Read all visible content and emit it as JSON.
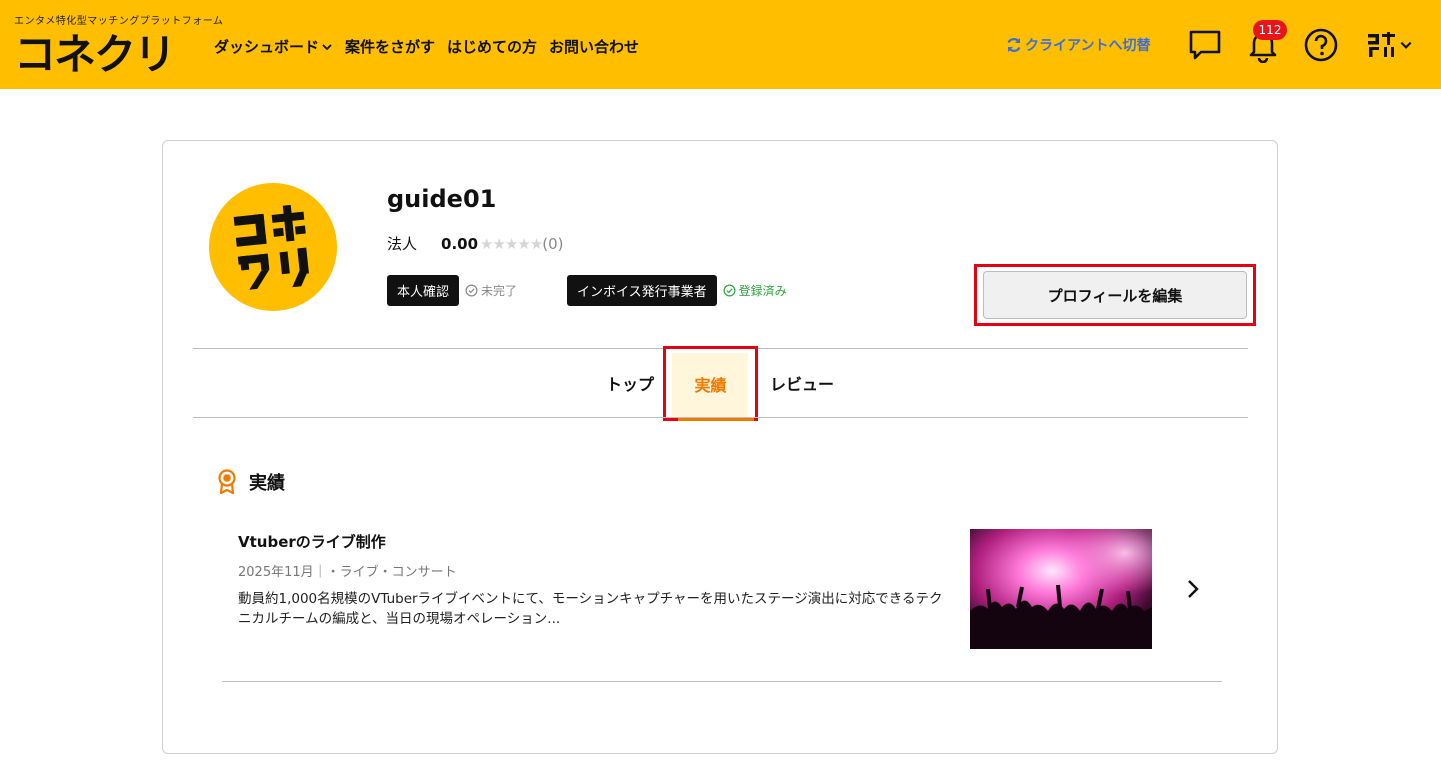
{
  "header": {
    "tagline": "エンタメ特化型マッチングプラットフォーム",
    "logo_text": "コネクリ",
    "nav": [
      {
        "label": "ダッシュボード"
      },
      {
        "label": "案件をさがす"
      },
      {
        "label": "はじめての方"
      },
      {
        "label": "お問い合わせ"
      }
    ],
    "switch_label": "クライアントへ切替",
    "notification_count": "112",
    "colors": {
      "bg": "#ffbf00",
      "link": "#3b6fd8",
      "badge": "#e8141a"
    }
  },
  "profile": {
    "avatar_text": "コネクリ",
    "username": "guide01",
    "type": "法人",
    "rating": "0.00",
    "stars": "★★★★★",
    "review_count": "(0)",
    "identity_tag": "本人確認",
    "identity_status": "未完了",
    "invoice_tag": "インボイス発行事業者",
    "invoice_status": "登録済み",
    "edit_button": "プロフィールを編集"
  },
  "tabs": [
    {
      "label": "トップ"
    },
    {
      "label": "実績",
      "active": true
    },
    {
      "label": "レビュー"
    }
  ],
  "section": {
    "title": "実績"
  },
  "works": [
    {
      "title": "Vtuberのライブ制作",
      "meta": "2025年11月｜・ライブ・コンサート",
      "description": "動員約1,000名規模のVTuberライブイベントにて、モーションキャプチャーを用いたステージ演出に対応できるテクニカルチームの編成と、当日の現場オペレーション..."
    }
  ]
}
